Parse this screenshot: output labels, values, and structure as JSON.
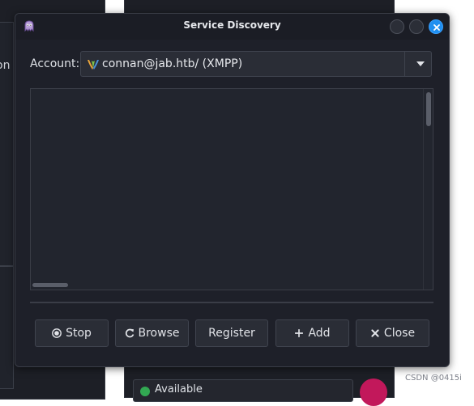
{
  "background": {
    "left_window_clip_text": "on",
    "bottom_status_text": "Available",
    "watermark": "CSDN @0415i"
  },
  "dialog": {
    "title": "Service Discovery",
    "app_icon": "pidgin-icon",
    "window_buttons": [
      "minimize-button",
      "maximize-button",
      "close-window-button"
    ]
  },
  "account": {
    "label": "Account:",
    "selected": "connan@jab.htb/ (XMPP)",
    "icon": "xmpp-protocol-icon"
  },
  "services_list": {
    "items": []
  },
  "buttons": {
    "stop": "Stop",
    "browse": "Browse",
    "register": "Register",
    "add": "Add",
    "close": "Close"
  },
  "colors": {
    "dialog_bg": "#1e2029",
    "close_accent": "#1f8ff0",
    "button_bg": "#2a2d36"
  }
}
